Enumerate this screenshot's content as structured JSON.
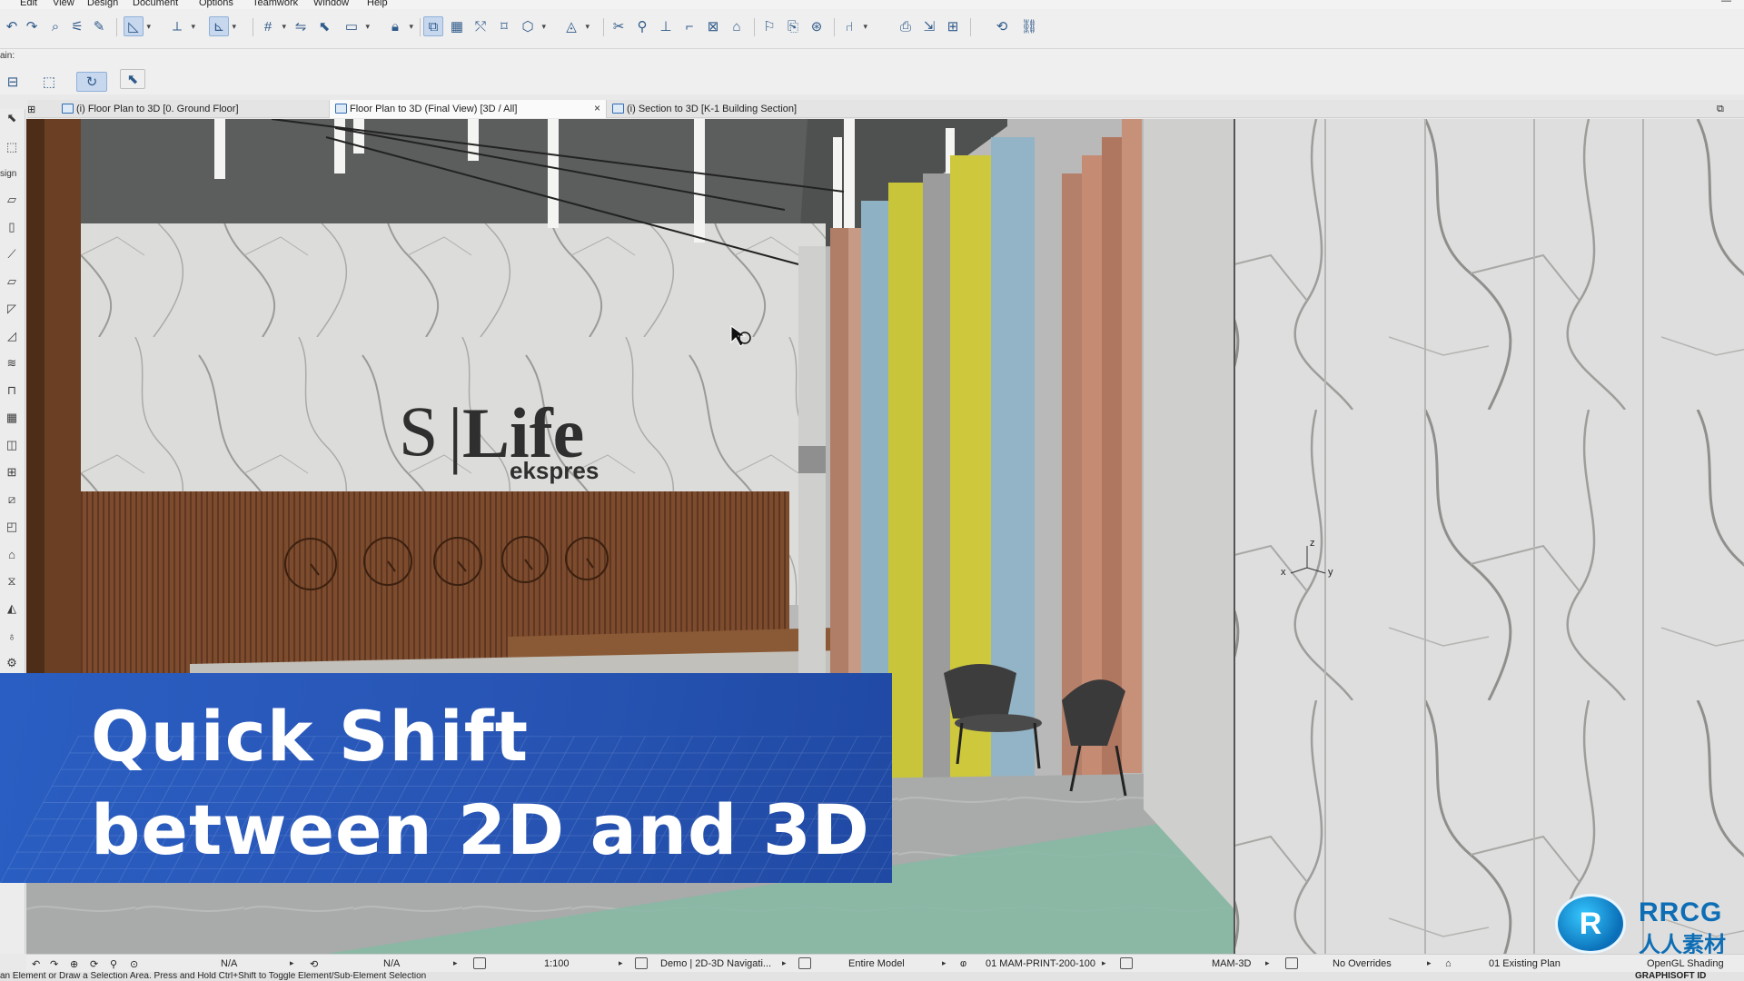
{
  "menu": [
    "Edit",
    "View",
    "Design",
    "Document",
    "Options",
    "Teamwork",
    "Window",
    "Help"
  ],
  "toolbar2": {
    "label": "ain:"
  },
  "toolbox": {
    "label": "sign"
  },
  "tabs": [
    {
      "label": "(i) Floor Plan to 3D [0. Ground Floor]"
    },
    {
      "label": "Floor Plan to 3D (Final View) [3D / All]",
      "close": "×"
    },
    {
      "label": "(i) Section to 3D [K-1 Building Section]"
    }
  ],
  "scene": {
    "sign_s": "S",
    "sign_divider": "|",
    "sign_life": "Life",
    "sign_ekspres": "ekspres",
    "axis_x": "x",
    "axis_y": "y",
    "axis_z": "z",
    "wall_colors": {
      "marble": "#d9d9d7",
      "wood": "#7a4a2c",
      "yellow": "#c8c53a",
      "blue": "#8fb1c4",
      "terracotta": "#b5806a",
      "floor": "#a9acaa",
      "ceiling": "#5a5a5a"
    }
  },
  "caption": {
    "line1": "Quick Shift",
    "line2": "between 2D and 3D"
  },
  "logo": {
    "text1": "RRCG",
    "text2": "人人素材"
  },
  "status": {
    "na1": "N/A",
    "na2": "N/A",
    "scale": "1:100",
    "nav": "Demo | 2D-3D Navigati...",
    "model": "Entire Model",
    "layer": "01 MAM-PRINT-200-100",
    "pen": "MAM-3D",
    "overrides": "No Overrides",
    "renovation": "01 Existing Plan",
    "shading": "OpenGL Shading"
  },
  "hint": {
    "text": "an Element or Draw a Selection Area. Press and Hold Ctrl+Shift to Toggle Element/Sub-Element Selection",
    "brand": "GRAPHISOFT ID"
  }
}
